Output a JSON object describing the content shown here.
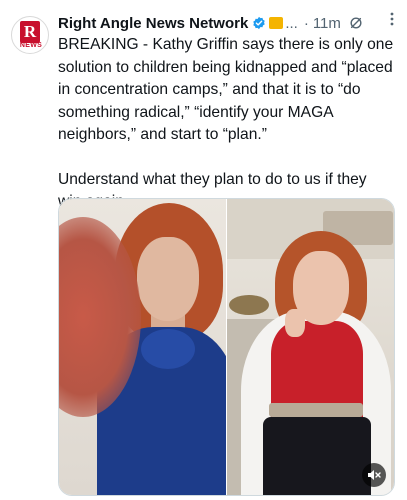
{
  "author": {
    "name": "Right Angle News Network",
    "avatar_letter": "R",
    "avatar_subtext": "NEWS",
    "truncation": "...",
    "timestamp": "11m"
  },
  "tweet": {
    "paragraph_1": "BREAKING - Kathy Griffin says there is only one solution to children being kidnapped and “placed in concentration camps,” and that it is to “do something radical,” “identify your MAGA neighbors,” and start to “plan.”",
    "paragraph_2": "Understand what they plan to do to us if they win again."
  },
  "icons": {
    "verified": "verified-badge-icon",
    "affiliate": "affiliate-badge-icon",
    "grok": "grok-icon",
    "more": "more-options-icon",
    "mute": "volume-muted-icon"
  },
  "colors": {
    "verified_blue": "#1d9bf0",
    "brand_red": "#c8102e",
    "secondary_text": "#536471"
  }
}
